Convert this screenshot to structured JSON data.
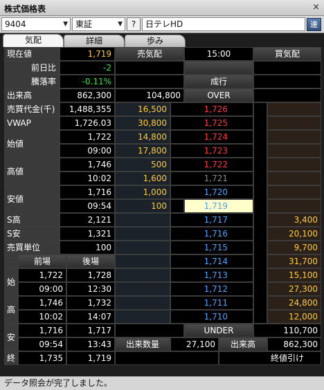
{
  "window": {
    "title": "株式価格表",
    "close": "×"
  },
  "toolbar": {
    "code": "9404",
    "market": "東証",
    "help": "?",
    "name": "日テレHD",
    "link_button": "連"
  },
  "tabs": [
    "気配",
    "詳細",
    "歩み"
  ],
  "info": {
    "current_label": "現在値",
    "current": "1,719",
    "change_label": "前日比",
    "change": "-2",
    "rate_label": "騰落率",
    "rate": "-0.11%",
    "volume_label": "出来高",
    "volume": "862,300",
    "turnover_label": "売買代金(千)",
    "turnover": "1,488,355",
    "vwap_label": "VWAP",
    "vwap": "1,726.03",
    "open_label": "始値",
    "open": "1,722",
    "open_time": "09:00",
    "high_label": "高値",
    "high": "1,746",
    "high_time": "10:02",
    "low_label": "安値",
    "low": "1,716",
    "low_time": "09:54",
    "s_high_label": "S高",
    "s_high": "2,121",
    "s_low_label": "S安",
    "s_low": "1,321",
    "unit_label": "売買単位",
    "unit": "100"
  },
  "board": {
    "sell_header": "売気配",
    "time": "15:00",
    "buy_header": "買気配",
    "market_order": "成行",
    "over": "OVER",
    "over_qty": "104,800",
    "under": "UNDER",
    "under_qty": "110,700",
    "rows": [
      {
        "sell": "16,500",
        "price": "1,726",
        "buy": "",
        "pc": "red"
      },
      {
        "sell": "30,800",
        "price": "1,725",
        "buy": "",
        "pc": "red"
      },
      {
        "sell": "14,800",
        "price": "1,724",
        "buy": "",
        "pc": "red"
      },
      {
        "sell": "17,800",
        "price": "1,723",
        "buy": "",
        "pc": "red"
      },
      {
        "sell": "500",
        "price": "1,722",
        "buy": "",
        "pc": "red"
      },
      {
        "sell": "1,600",
        "price": "1,721",
        "buy": "",
        "pc": "gray"
      },
      {
        "sell": "1,000",
        "price": "1,720",
        "buy": "",
        "pc": "blue"
      },
      {
        "sell": "100",
        "price": "1,719",
        "buy": "",
        "pc": "current"
      },
      {
        "sell": "",
        "price": "1,717",
        "buy": "3,400",
        "pc": "blue"
      },
      {
        "sell": "",
        "price": "1,716",
        "buy": "20,100",
        "pc": "blue"
      },
      {
        "sell": "",
        "price": "1,715",
        "buy": "9,700",
        "pc": "blue"
      },
      {
        "sell": "",
        "price": "1,714",
        "buy": "31,700",
        "pc": "blue"
      },
      {
        "sell": "",
        "price": "1,713",
        "buy": "15,100",
        "pc": "blue"
      },
      {
        "sell": "",
        "price": "1,712",
        "buy": "27,300",
        "pc": "blue"
      },
      {
        "sell": "",
        "price": "1,711",
        "buy": "24,800",
        "pc": "blue"
      },
      {
        "sell": "",
        "price": "1,710",
        "buy": "12,000",
        "pc": "blue"
      }
    ]
  },
  "session": {
    "am_header": "前場",
    "pm_header": "後場",
    "open_label": "始",
    "high_label": "高",
    "low_label": "安",
    "close_label": "終",
    "am_open": "1,722",
    "pm_open": "1,728",
    "am_open_time": "09:00",
    "pm_open_time": "12:30",
    "am_high": "1,746",
    "pm_high": "1,732",
    "am_high_time": "10:02",
    "pm_high_time": "14:07",
    "am_low": "1,716",
    "pm_low": "1,717",
    "am_low_time": "09:54",
    "pm_low_time": "13:43",
    "am_close": "1,735",
    "pm_close": "1,719"
  },
  "footer": {
    "trade_qty_label": "出来数量",
    "trade_qty": "27,100",
    "volume_label": "出来高",
    "volume": "862,300",
    "closing_note": "終値引け"
  },
  "status": "データ照会が完了しました。"
}
